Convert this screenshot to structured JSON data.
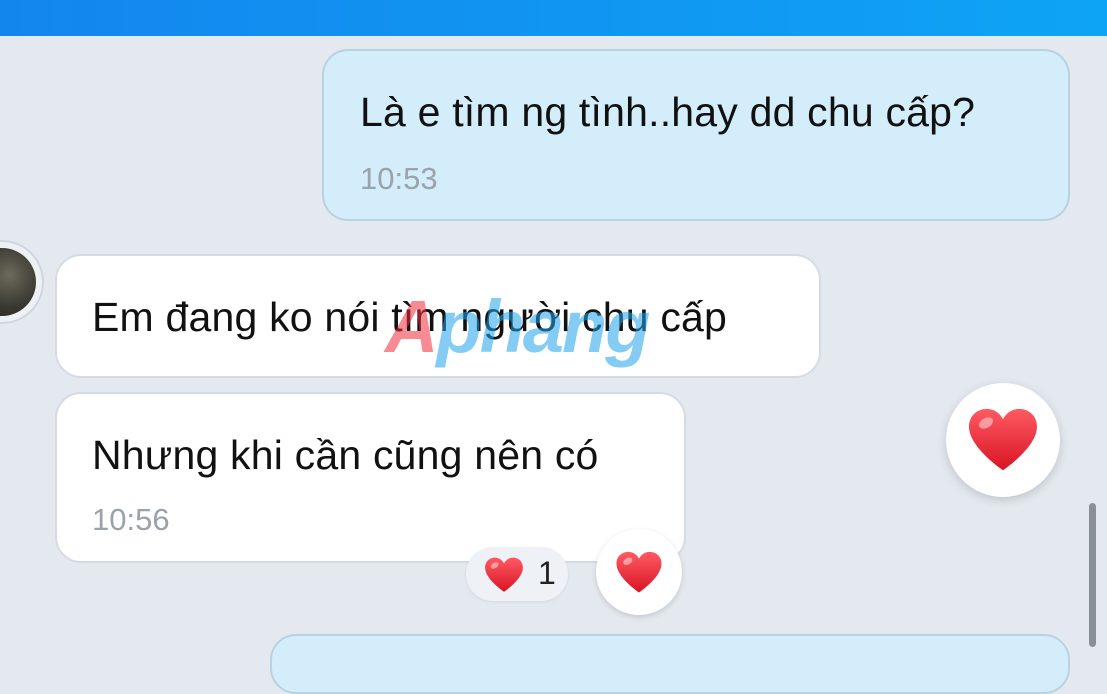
{
  "colors": {
    "header": "#0ea4f5",
    "sent_bubble": "#d4edfb",
    "received_bubble": "#ffffff",
    "heart": "#ef2d3b"
  },
  "messages": [
    {
      "direction": "outgoing",
      "text": "Là e tìm ng tình..hay dd chu cấp?",
      "time": "10:53"
    },
    {
      "direction": "incoming",
      "text": "Em đang ko nói tìm người chu cấp"
    },
    {
      "direction": "incoming",
      "text": "Nhưng khi cần cũng nên có",
      "time": "10:56"
    }
  ],
  "reactions": {
    "icon": "heart-icon",
    "count": "1"
  },
  "quick_reaction": {
    "icon": "heart-icon"
  },
  "watermark": {
    "text_a": "A",
    "text_rest": "phang"
  }
}
